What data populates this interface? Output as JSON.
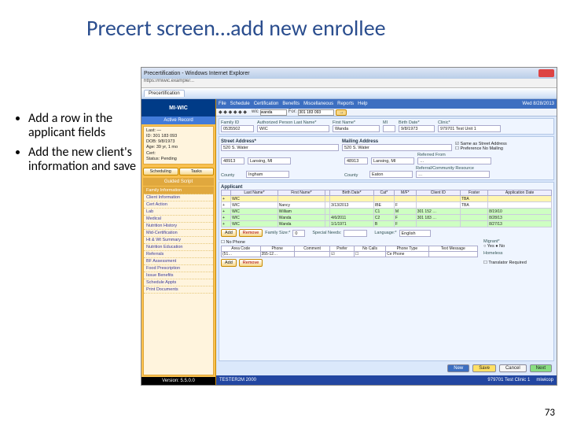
{
  "slide": {
    "title": "Precert screen…add new enrollee",
    "bullets": [
      "Add a row in the applicant fields",
      "Add the new client's information and save"
    ],
    "page_number": "73"
  },
  "browser": {
    "window_title": "Precertification - Windows Internet Explorer",
    "tab_label": "Precertification"
  },
  "app": {
    "logo": "MI-WIC",
    "active_record_label": "Active Record",
    "record": {
      "line1": "Last: —",
      "line2": "ID: 301 183 093",
      "line3": "DOB: 9/8/1973",
      "line4": "Age: 39 yr, 1 mo",
      "line5": "Cert:",
      "line6": "Status: Pending"
    },
    "side_buttons": {
      "scheduling": "Scheduling",
      "tasks": "Tasks"
    },
    "guided_script": "Guided Script",
    "nav": [
      "Family Information",
      "Client Information",
      "Cert Action",
      "Lab",
      "Medical",
      "Nutrition History",
      "Mid-Certification",
      "Ht & Wt Summary",
      "Nutrition Education",
      "Referrals",
      "BF Assessment",
      "Food Prescription",
      "Issue Benefits",
      "Schedule Appts",
      "Print Documents"
    ],
    "version": "Version: 5.5.0.0",
    "menubar": {
      "items": [
        "File",
        "Schedule",
        "Certification",
        "Benefits",
        "Miscellaneous",
        "Reports",
        "Help"
      ],
      "date": "Wed 8/28/2013"
    },
    "search": {
      "label1": "wic",
      "field1": "wanda",
      "label2": "For:",
      "field2": "301 183 093",
      "go": "→"
    },
    "family_id": {
      "label": "Family ID",
      "value": "0535502"
    },
    "auth_last": {
      "label": "Authorized Person Last Name*",
      "value": "WIC"
    },
    "first_name": {
      "label": "First Name*",
      "value": "Wanda"
    },
    "mi": {
      "label": "MI",
      "value": ""
    },
    "birth_date": {
      "label": "Birth Date*",
      "value": "9/8/1973"
    },
    "clinic": {
      "label": "Clinic*",
      "value": "979701 Test Unit 1"
    },
    "street_label": "Street Address*",
    "street_value": "520 S. Water",
    "mailing_label": "Mailing Address",
    "mailing_value": "520 S. Water",
    "same_as_street": "Same as Street Address",
    "pref_no_mail": "Preference No Mailing",
    "city1": "48913",
    "city1_name": "Lansing, MI",
    "city2": "48913",
    "city2_name": "Lansing, MI",
    "county_label": "County",
    "county1": "Ingham",
    "county2_label": "County",
    "county2": "Eaton",
    "referred_from": {
      "label": "Referred From",
      "value": "…"
    },
    "ref_comm": {
      "label": "Referral/Community Resource",
      "value": "…"
    },
    "applicant_label": "Applicant",
    "appl_headers": [
      "",
      "Last Name*",
      "First Name*",
      "",
      "Birth Date*",
      "Cat*",
      "M/F*",
      "Client ID",
      "Foster",
      "Application Date"
    ],
    "appl_rows": [
      {
        "cls": "yel",
        "last": "WIC",
        "first": "",
        "bd": "",
        "cat": "",
        "mf": "",
        "cid": "",
        "foster": "TBA",
        "ad": ""
      },
      {
        "cls": "",
        "last": "WIC",
        "first": "Nancy",
        "bd": "3/13/2013",
        "cat": "IBE",
        "mf": "F",
        "cid": "",
        "foster": "TBA",
        "ad": ""
      },
      {
        "cls": "grn",
        "last": "WIC",
        "first": "William",
        "bd": "",
        "cat": "C1",
        "mf": "M",
        "cid": "301 152 …",
        "foster": "",
        "ad": "8/19/10"
      },
      {
        "cls": "grn",
        "last": "WIC",
        "first": "Wanda",
        "bd": "4/6/2011",
        "cat": "C2",
        "mf": "F",
        "cid": "301 183 …",
        "foster": "",
        "ad": "8/28/13"
      },
      {
        "cls": "grn",
        "last": "WIC",
        "first": "Wanda",
        "bd": "1/1/1971",
        "cat": "B",
        "mf": "F",
        "cid": "",
        "foster": "",
        "ad": "8/27/13"
      }
    ],
    "add_btn": "Add",
    "remove_btn": "Remove",
    "family_size": {
      "label": "Family Size:*",
      "value": "0"
    },
    "special_needs": "Special Needs:",
    "language": {
      "label": "Language:*",
      "value": "English"
    },
    "no_phone": "No Phone",
    "phone_headers": [
      "Area Code",
      "Phone",
      "Comment",
      "Prefer",
      "No Calls",
      "Phone Type",
      "Text Message"
    ],
    "phone_row": {
      "area": "(51…",
      "phone": "355-12…",
      "comment": "",
      "prefer": "☑",
      "nocalls": "☐",
      "type": "Ce Phone",
      "text": ""
    },
    "migrant_label": "Migrant*",
    "migrant_opts": "○ Yes  ● No",
    "homeless_label": "Homeless",
    "translator": "Translator Required",
    "foot_buttons": {
      "new": "New",
      "save": "Save",
      "cancel": "Cancel",
      "next": "Next"
    },
    "status": {
      "tester": "TESTER2M 2000",
      "clinic": "979701 Test Clinic 1",
      "user": "miwicop"
    }
  }
}
